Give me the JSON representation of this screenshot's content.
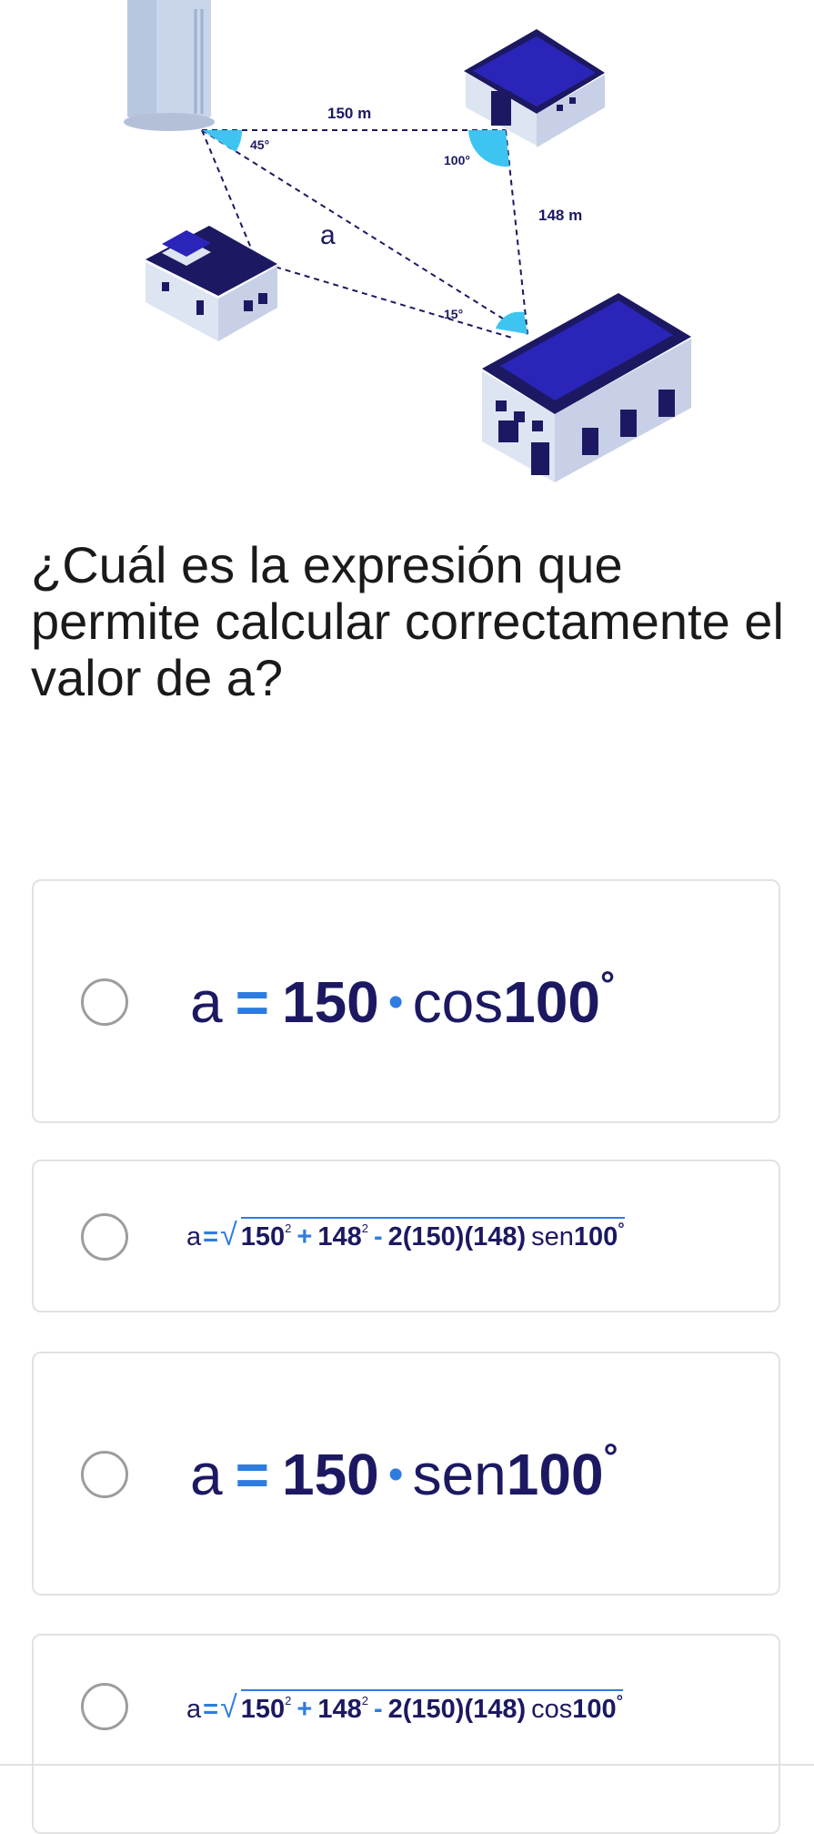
{
  "figure": {
    "labels": {
      "side_top": "150 m",
      "side_right": "148 m",
      "side_diagonal": "a",
      "angle_left": "45°",
      "angle_top_right": "100°",
      "angle_bottom": "15°"
    },
    "colors": {
      "roof": "#1c1962",
      "roof_accent": "#2a25b8",
      "wall": "#dde4f2",
      "wall_side": "#c7d0e6",
      "angle_fill": "#3ec4f0",
      "dashed_line": "#1c1962"
    }
  },
  "question": {
    "text": "¿Cuál es la expresión que permite calcular correctamente el valor de a?"
  },
  "options": [
    {
      "var": "a",
      "eq": "=",
      "coef": "150",
      "dot": "•",
      "fn": "cos",
      "angle": "100",
      "deg": "°",
      "selected": false
    },
    {
      "var": "a",
      "eq": "=",
      "root": "√",
      "term1": "150",
      "sup1": "2",
      "plus": "+",
      "term2": "148",
      "sup2": "2",
      "minus": "-",
      "two": "2",
      "paren1": "(150)",
      "paren2": "(148)",
      "fn": "sen",
      "angle": "100",
      "deg": "°",
      "selected": false
    },
    {
      "var": "a",
      "eq": "=",
      "coef": "150",
      "dot": "•",
      "fn": "sen",
      "angle": "100",
      "deg": "°",
      "selected": false
    },
    {
      "var": "a",
      "eq": "=",
      "root": "√",
      "term1": "150",
      "sup1": "2",
      "plus": "+",
      "term2": "148",
      "sup2": "2",
      "minus": "-",
      "two": "2",
      "paren1": "(150)",
      "paren2": "(148)",
      "fn": "cos",
      "angle": "100",
      "deg": "°",
      "selected": false
    }
  ]
}
